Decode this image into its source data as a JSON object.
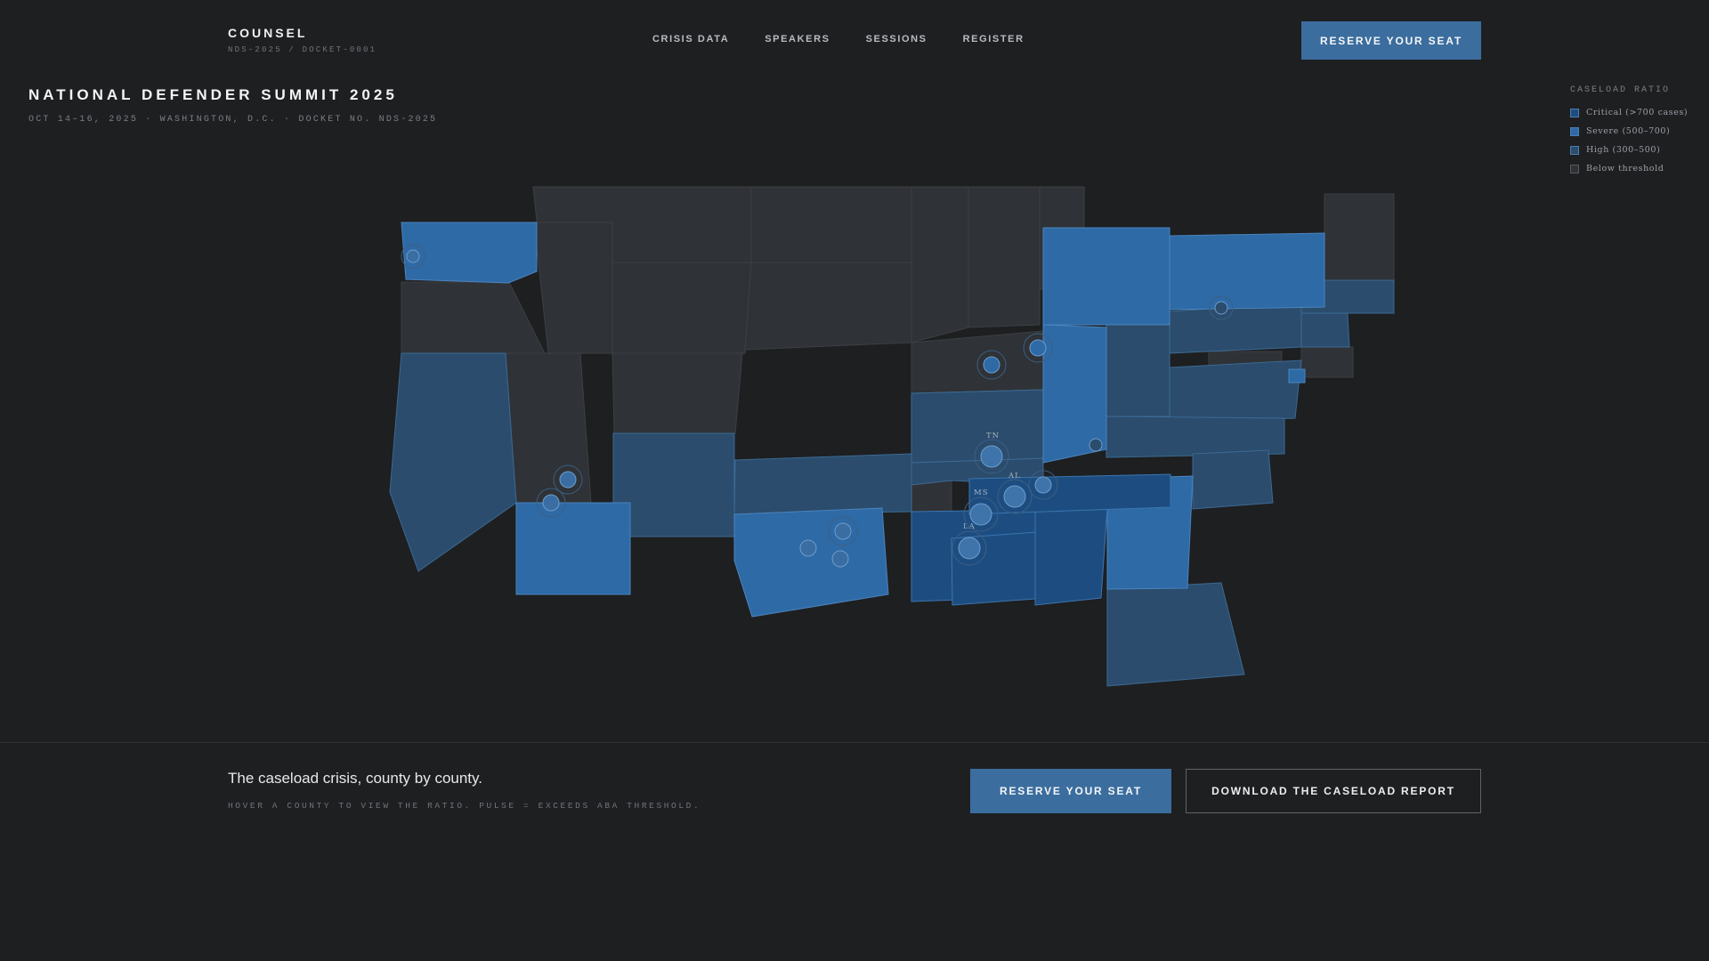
{
  "header": {
    "brand": "COUNSEL",
    "brand_sub": "NDS-2025 / DOCKET-0001",
    "nav": [
      "CRISIS DATA",
      "SPEAKERS",
      "SESSIONS",
      "REGISTER"
    ],
    "cta": "RESERVE YOUR SEAT"
  },
  "hero": {
    "title": "NATIONAL DEFENDER SUMMIT 2025",
    "subtitle": "OCT 14–16, 2025 · WASHINGTON, D.C. · DOCKET NO. NDS-2025"
  },
  "legend": {
    "title": "CASELOAD RATIO",
    "items": [
      {
        "label": "Critical (>700 cases)",
        "color": "#1d4d80"
      },
      {
        "label": "Severe (500–700)",
        "color": "#2e6aa6"
      },
      {
        "label": "High (300–500)",
        "color": "#2b4c6c"
      },
      {
        "label": "Below threshold",
        "color": "#2f3236"
      }
    ]
  },
  "map": {
    "labels": [
      "TN",
      "AL",
      "MS",
      "LA"
    ]
  },
  "footer": {
    "heading": "The caseload crisis, county by county.",
    "hint": "HOVER A COUNTY TO VIEW THE RATIO. PULSE = EXCEEDS ABA THRESHOLD.",
    "primary": "RESERVE YOUR SEAT",
    "secondary": "DOWNLOAD THE CASELOAD REPORT"
  }
}
